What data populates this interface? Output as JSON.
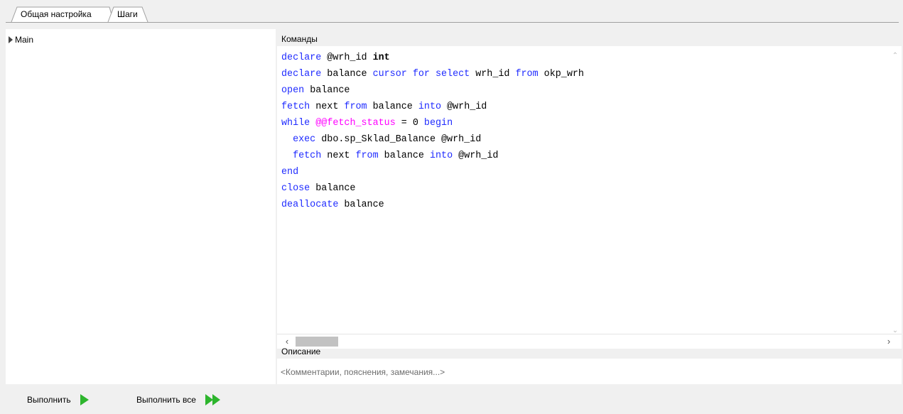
{
  "tabs": [
    {
      "label": "Общая настройка"
    },
    {
      "label": "Шаги"
    }
  ],
  "tree": {
    "items": [
      {
        "label": "Main"
      }
    ]
  },
  "commands": {
    "title": "Команды",
    "code_lines": [
      [
        {
          "t": "declare",
          "c": "kw"
        },
        {
          "t": " @wrh_id ",
          "c": "pl"
        },
        {
          "t": "int",
          "c": "bold"
        }
      ],
      [
        {
          "t": "declare",
          "c": "kw"
        },
        {
          "t": " balance ",
          "c": "pl"
        },
        {
          "t": "cursor for select",
          "c": "kw"
        },
        {
          "t": " wrh_id ",
          "c": "pl"
        },
        {
          "t": "from",
          "c": "kw"
        },
        {
          "t": " okp_wrh",
          "c": "pl"
        }
      ],
      [
        {
          "t": "open",
          "c": "kw"
        },
        {
          "t": " balance",
          "c": "pl"
        }
      ],
      [
        {
          "t": "fetch",
          "c": "kw"
        },
        {
          "t": " next ",
          "c": "pl"
        },
        {
          "t": "from",
          "c": "kw"
        },
        {
          "t": " balance ",
          "c": "pl"
        },
        {
          "t": "into",
          "c": "kw"
        },
        {
          "t": " @wrh_id",
          "c": "pl"
        }
      ],
      [
        {
          "t": "while",
          "c": "kw"
        },
        {
          "t": " ",
          "c": "pl"
        },
        {
          "t": "@@fetch_status",
          "c": "sys"
        },
        {
          "t": " = 0 ",
          "c": "pl"
        },
        {
          "t": "begin",
          "c": "kw"
        }
      ],
      [
        {
          "t": "  ",
          "c": "pl"
        },
        {
          "t": "exec",
          "c": "kw"
        },
        {
          "t": " dbo.sp_Sklad_Balance @wrh_id",
          "c": "pl"
        }
      ],
      [
        {
          "t": "  ",
          "c": "pl"
        },
        {
          "t": "fetch",
          "c": "kw"
        },
        {
          "t": " next ",
          "c": "pl"
        },
        {
          "t": "from",
          "c": "kw"
        },
        {
          "t": " balance ",
          "c": "pl"
        },
        {
          "t": "into",
          "c": "kw"
        },
        {
          "t": " @wrh_id",
          "c": "pl"
        }
      ],
      [
        {
          "t": "end",
          "c": "kw"
        }
      ],
      [
        {
          "t": "close",
          "c": "kw"
        },
        {
          "t": " balance",
          "c": "pl"
        }
      ],
      [
        {
          "t": "deallocate",
          "c": "kw"
        },
        {
          "t": " balance",
          "c": "pl"
        }
      ]
    ]
  },
  "description": {
    "title": "Описание",
    "placeholder": "<Комментарии, пояснения, замечания...>"
  },
  "toolbar": {
    "run_label": "Выполнить",
    "run_all_label": "Выполнить все"
  },
  "colors": {
    "keyword": "#1f2bff",
    "system_var": "#ff00ff",
    "run_icon": "#2db52d"
  }
}
